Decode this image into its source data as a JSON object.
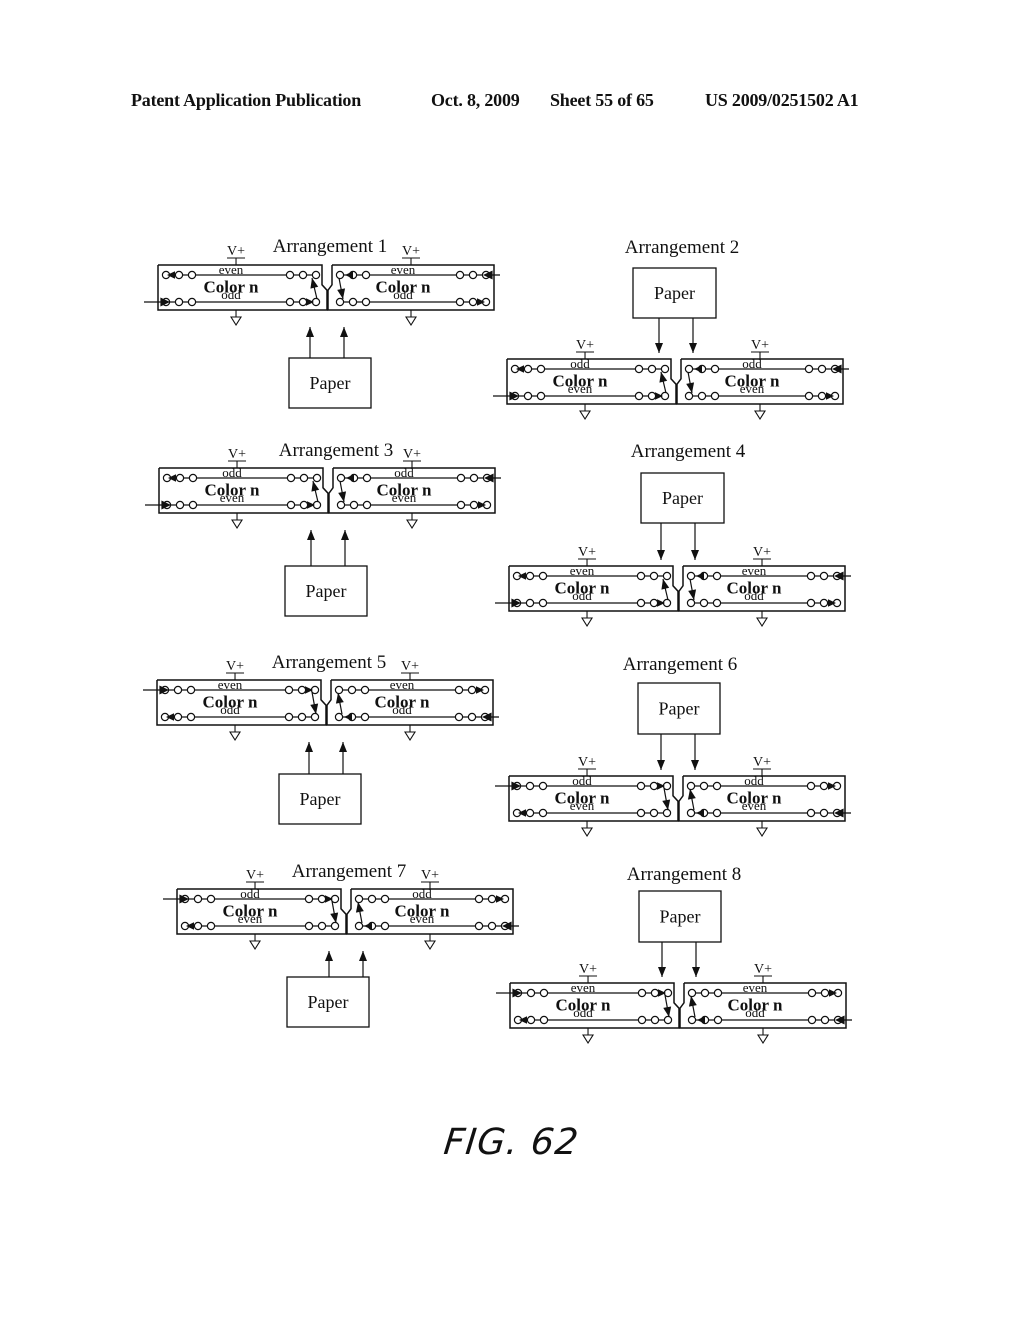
{
  "header": {
    "publication": "Patent Application Publication",
    "date": "Oct. 8, 2009",
    "sheet": "Sheet 55 of 65",
    "patent_number": "US 2009/0251502 A1"
  },
  "figure_label": "FIG. 62",
  "labels": {
    "color": "Color n",
    "vplus": "V+",
    "paper": "Paper"
  },
  "arrangements": [
    {
      "title": "Arrangement 1",
      "column": "left",
      "paper": "below",
      "top_row": "even",
      "bottom_row": "odd",
      "input_row": "bottom"
    },
    {
      "title": "Arrangement 2",
      "column": "right",
      "paper": "above",
      "top_row": "odd",
      "bottom_row": "even",
      "input_row": "bottom"
    },
    {
      "title": "Arrangement 3",
      "column": "left",
      "paper": "below",
      "top_row": "odd",
      "bottom_row": "even",
      "input_row": "bottom"
    },
    {
      "title": "Arrangement 4",
      "column": "right",
      "paper": "above",
      "top_row": "even",
      "bottom_row": "odd",
      "input_row": "bottom"
    },
    {
      "title": "Arrangement 5",
      "column": "left",
      "paper": "below",
      "top_row": "even",
      "bottom_row": "odd",
      "input_row": "top"
    },
    {
      "title": "Arrangement 6",
      "column": "right",
      "paper": "above",
      "top_row": "odd",
      "bottom_row": "even",
      "input_row": "top"
    },
    {
      "title": "Arrangement 7",
      "column": "left",
      "paper": "below",
      "top_row": "odd",
      "bottom_row": "even",
      "input_row": "top"
    },
    {
      "title": "Arrangement 8",
      "column": "right",
      "paper": "above",
      "top_row": "even",
      "bottom_row": "odd",
      "input_row": "top"
    }
  ]
}
